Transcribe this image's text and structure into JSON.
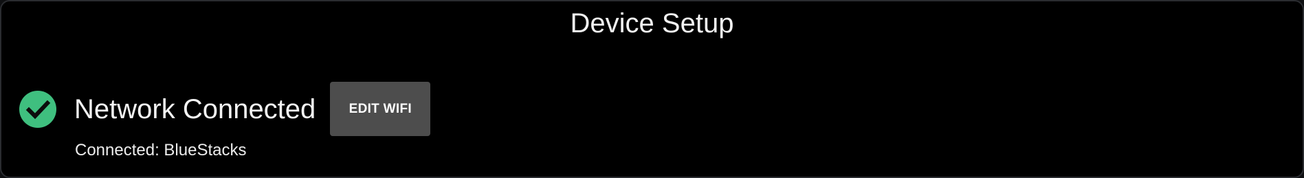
{
  "header": {
    "title": "Device Setup"
  },
  "network": {
    "status_icon": "check-circle-icon",
    "status_icon_color": "#3fbf7f",
    "status_label": "Network Connected",
    "edit_button_label": "EDIT WIFI",
    "detail_text": "Connected: BlueStacks"
  }
}
